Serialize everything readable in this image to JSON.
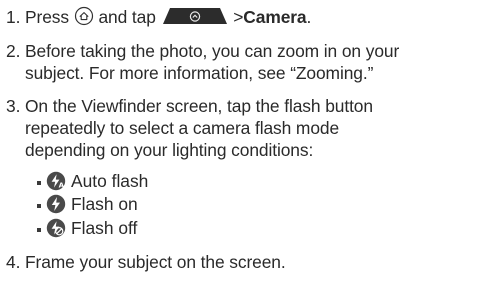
{
  "steps": [
    {
      "number": "1.",
      "prefix": "Press",
      "middle": "and tap",
      "separator": ">",
      "target": "Camera",
      "suffix": "."
    },
    {
      "number": "2.",
      "lines": [
        "Before taking the photo, you can zoom in on your",
        "subject. For more information, see “Zooming.”"
      ]
    },
    {
      "number": "3.",
      "lines": [
        "On the Viewfinder screen, tap the flash button",
        "repeatedly to select a camera flash mode",
        "depending on your lighting conditions:"
      ],
      "flash_modes": [
        {
          "label": "Auto flash",
          "icon": "flash-auto-icon"
        },
        {
          "label": "Flash on",
          "icon": "flash-on-icon"
        },
        {
          "label": "Flash off",
          "icon": "flash-off-icon"
        }
      ]
    },
    {
      "number": "4.",
      "lines": [
        "Frame your subject on the screen."
      ]
    }
  ]
}
